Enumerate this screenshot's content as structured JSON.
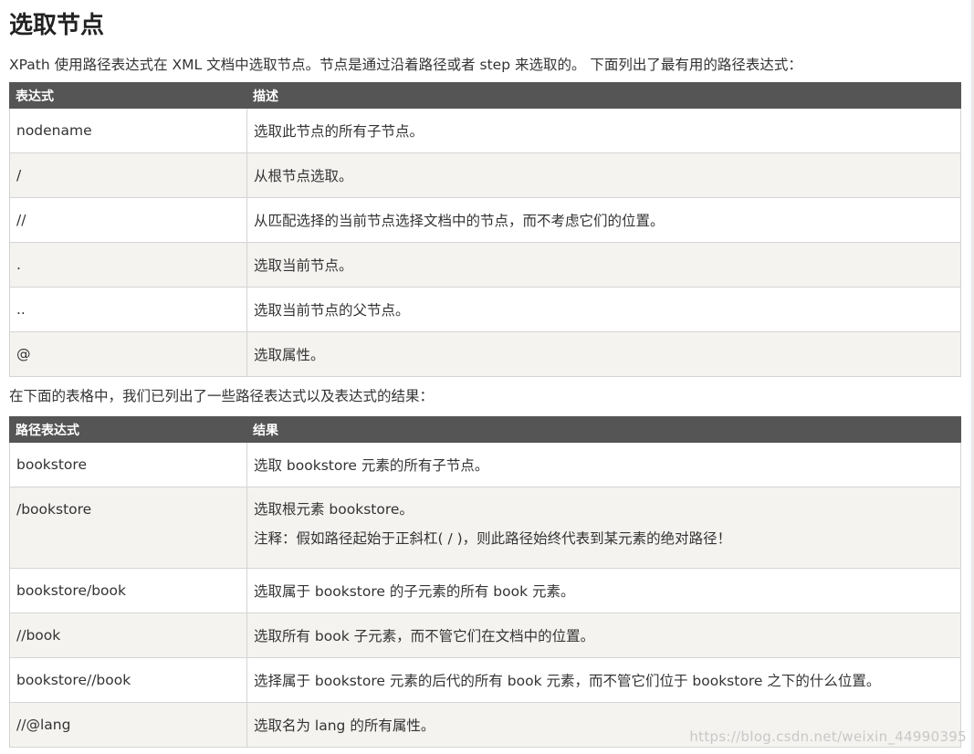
{
  "title": "选取节点",
  "intro": "XPath 使用路径表达式在 XML 文档中选取节点。节点是通过沿着路径或者 step 来选取的。 下面列出了最有用的路径表达式：",
  "table1": {
    "headers": [
      "表达式",
      "描述"
    ],
    "rows": [
      {
        "expr": "nodename",
        "desc": "选取此节点的所有子节点。"
      },
      {
        "expr": "/",
        "desc": "从根节点选取。"
      },
      {
        "expr": "//",
        "desc": "从匹配选择的当前节点选择文档中的节点，而不考虑它们的位置。"
      },
      {
        "expr": ".",
        "desc": "选取当前节点。"
      },
      {
        "expr": "..",
        "desc": "选取当前节点的父节点。"
      },
      {
        "expr": "@",
        "desc": "选取属性。"
      }
    ]
  },
  "mid_text": "在下面的表格中，我们已列出了一些路径表达式以及表达式的结果：",
  "table2": {
    "headers": [
      "路径表达式",
      "结果"
    ],
    "rows": [
      {
        "expr": "bookstore",
        "desc": "选取 bookstore 元素的所有子节点。"
      },
      {
        "expr": "/bookstore",
        "desc": "选取根元素 bookstore。",
        "note": "注释：假如路径起始于正斜杠( / )，则此路径始终代表到某元素的绝对路径！"
      },
      {
        "expr": "bookstore/book",
        "desc": "选取属于 bookstore 的子元素的所有 book 元素。"
      },
      {
        "expr": "//book",
        "desc": "选取所有 book 子元素，而不管它们在文档中的位置。"
      },
      {
        "expr": "bookstore//book",
        "desc": "选择属于 bookstore 元素的后代的所有 book 元素，而不管它们位于 bookstore 之下的什么位置。"
      },
      {
        "expr": "//@lang",
        "desc": "选取名为 lang 的所有属性。"
      }
    ]
  },
  "watermark": "https://blog.csdn.net/weixin_44990395"
}
